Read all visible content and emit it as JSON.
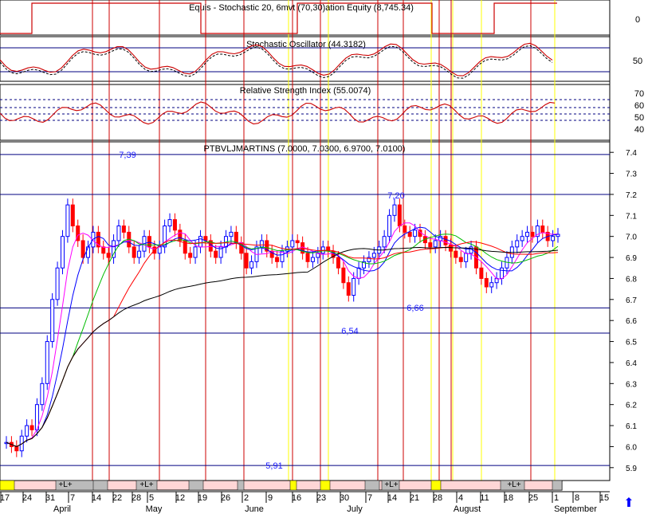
{
  "panels": {
    "equity": {
      "title": "Equis - Stochastic 20, 6mvt (70,30)ation Equity (8,745.34)",
      "axis_label": "0"
    },
    "stochastic": {
      "title": "Stochastic Oscillator (44.3182)",
      "axis_label": "50"
    },
    "rsi": {
      "title": "Relative Strength Index (55.0074)",
      "axis_labels": [
        "70",
        "60",
        "50",
        "40"
      ]
    },
    "price": {
      "title": "PTBVLJMARTINS (7.0000, 7.0300, 6.9700, 7.0100)"
    }
  },
  "annotations": [
    "7,39",
    "7,20",
    "6,66",
    "6,54",
    "5,91"
  ],
  "date_axis": {
    "days": [
      "17",
      "24",
      "31",
      "7",
      "14",
      "22",
      "28",
      "5",
      "12",
      "19",
      "26",
      "2",
      "9",
      "16",
      "23",
      "30",
      "7",
      "14",
      "21",
      "28",
      "4",
      "11",
      "18",
      "25",
      "1",
      "8",
      "15"
    ],
    "months": [
      "April",
      "May",
      "June",
      "July",
      "August",
      "September"
    ]
  },
  "volume_markers": [
    "+L+",
    "+L+",
    "+L+",
    "+L+"
  ],
  "colors": {
    "up": "#0000ff",
    "down": "#ff0000",
    "grid": "#000080",
    "signal_red": "#cc0000",
    "signal_yellow": "#ffff00",
    "ma_black": "#000000",
    "ma_red": "#ff0000",
    "ma_green": "#00bb00",
    "ma_blue": "#0000ff",
    "ma_magenta": "#ff00ff"
  },
  "chart_data": {
    "type": "candlestick",
    "title": "PTBVLJMARTINS (7.0000, 7.0300, 6.9700, 7.0100)",
    "y_ticks": [
      5.9,
      6.0,
      6.1,
      6.2,
      6.3,
      6.4,
      6.5,
      6.6,
      6.7,
      6.8,
      6.9,
      7.0,
      7.1,
      7.2,
      7.3,
      7.4
    ],
    "ylim": [
      5.85,
      7.45
    ],
    "horizontal_levels": [
      7.39,
      7.2,
      6.66,
      6.54,
      5.91
    ],
    "last": {
      "open": 7.0,
      "high": 7.03,
      "low": 6.97,
      "close": 7.01
    },
    "closes": [
      6.02,
      6.0,
      5.98,
      6.05,
      6.1,
      6.08,
      6.2,
      6.3,
      6.5,
      6.7,
      6.85,
      7.0,
      7.15,
      7.05,
      6.98,
      6.9,
      6.95,
      7.02,
      6.95,
      6.92,
      6.9,
      6.98,
      7.05,
      7.02,
      6.95,
      6.9,
      6.93,
      7.0,
      6.95,
      6.92,
      6.95,
      7.05,
      7.08,
      7.03,
      6.98,
      6.92,
      6.9,
      6.95,
      7.0,
      6.98,
      6.93,
      6.9,
      6.95,
      7.0,
      7.02,
      6.97,
      6.92,
      6.85,
      6.88,
      6.95,
      6.98,
      6.93,
      6.9,
      6.88,
      6.93,
      6.95,
      6.98,
      6.97,
      6.92,
      6.88,
      6.9,
      6.92,
      6.95,
      6.93,
      6.9,
      6.85,
      6.78,
      6.72,
      6.8,
      6.85,
      6.88,
      6.9,
      6.92,
      6.95,
      7.0,
      7.1,
      7.15,
      7.05,
      7.02,
      7.0,
      7.03,
      7.0,
      6.97,
      6.95,
      6.98,
      7.0,
      6.96,
      6.93,
      6.9,
      6.88,
      6.92,
      6.95,
      6.85,
      6.8,
      6.76,
      6.78,
      6.8,
      6.85,
      6.9,
      6.95,
      6.98,
      7.0,
      7.02,
      7.0,
      7.05,
      7.02,
      6.98,
      7.0,
      7.01
    ]
  }
}
